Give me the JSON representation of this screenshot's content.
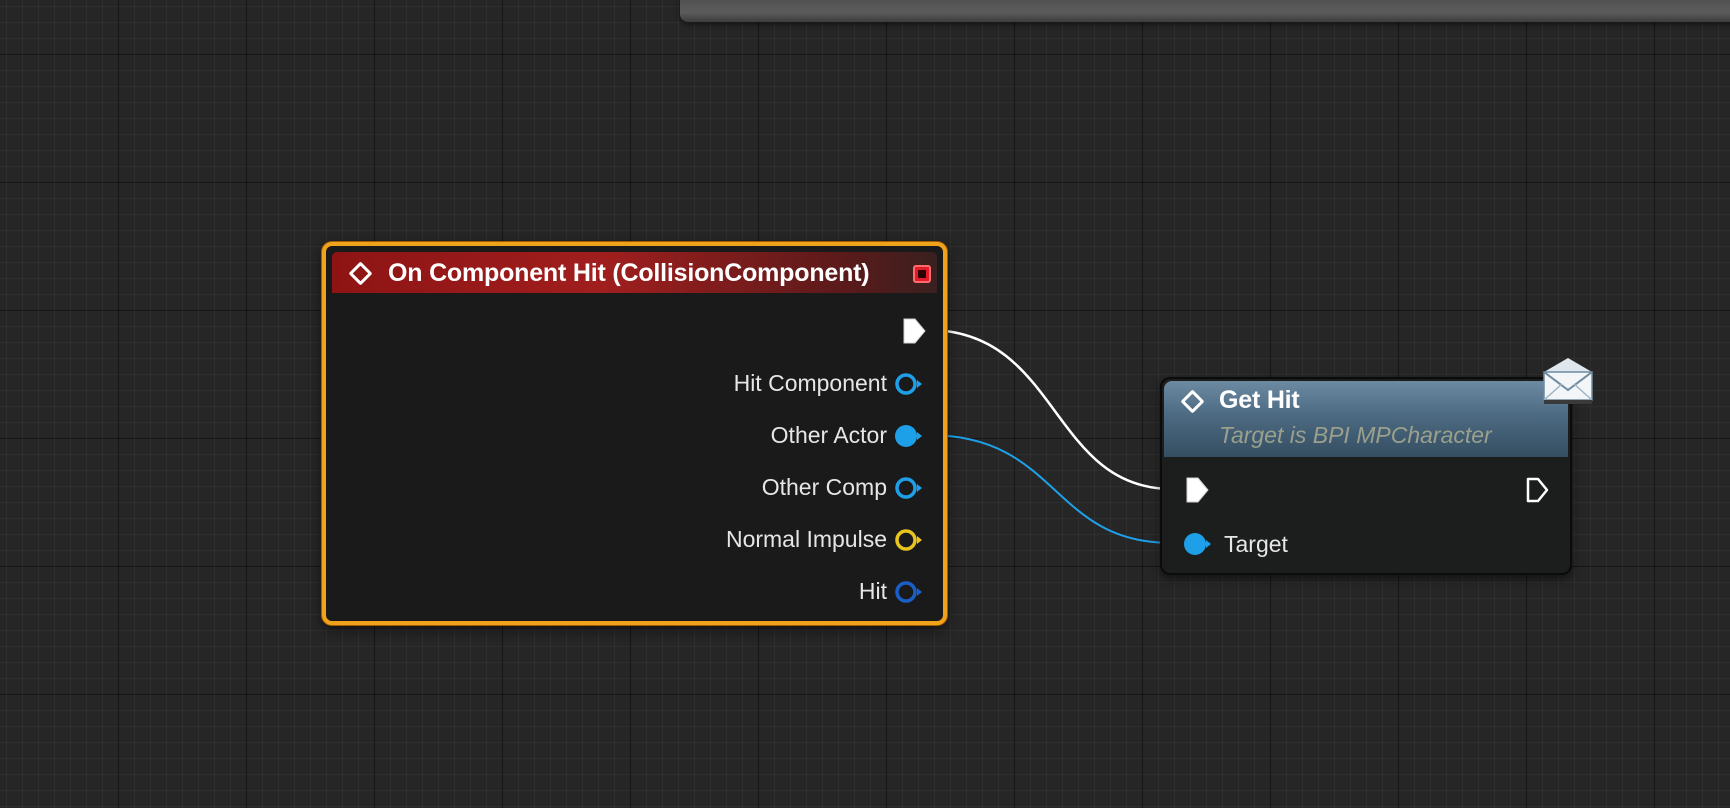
{
  "graph": {
    "event_node": {
      "title": "On Component Hit (CollisionComponent)",
      "pins": [
        {
          "label": "Hit Component",
          "type": "object",
          "color": "#1ea0e8",
          "connected": false
        },
        {
          "label": "Other Actor",
          "type": "object",
          "color": "#1ea0e8",
          "connected": true
        },
        {
          "label": "Other Comp",
          "type": "object",
          "color": "#1ea0e8",
          "connected": false
        },
        {
          "label": "Normal Impulse",
          "type": "vector",
          "color": "#e8c41e",
          "connected": false
        },
        {
          "label": "Hit",
          "type": "struct",
          "color": "#1a5fc8",
          "connected": false
        }
      ]
    },
    "call_node": {
      "title": "Get Hit",
      "subtitle": "Target is BPI MPCharacter",
      "pins": [
        {
          "label": "Target",
          "type": "object",
          "color": "#1ea0e8",
          "connected": true
        }
      ],
      "icon": "message-envelope-icon"
    },
    "colors": {
      "event_border": "#f0a31a",
      "event_header": "#a01e1e",
      "call_header": "#4c6a82",
      "exec_wire": "#ffffff",
      "object_wire": "#1ea0e8"
    }
  }
}
